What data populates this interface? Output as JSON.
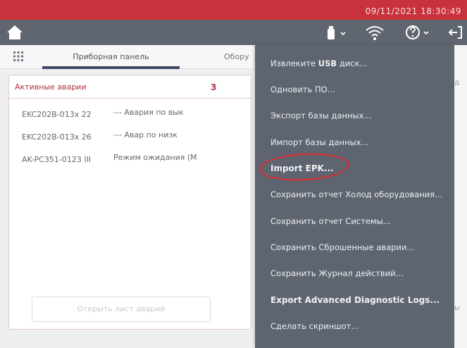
{
  "status_bar": {
    "datetime": "09/11/2021 18:30:49"
  },
  "tabs": [
    {
      "label": "Приборная панель"
    },
    {
      "label": "Обору"
    }
  ],
  "alarms": {
    "title": "Активные аварии",
    "count": "3",
    "rows": [
      {
        "device": "EKC202B-013x 22",
        "description": "--- Авария по вык"
      },
      {
        "device": "EKC202B-013x 26",
        "description": "--- Авар по низк"
      },
      {
        "device": "AK-PC351-0123 III",
        "description": "Режим ожидания (М"
      }
    ],
    "open_button": "Открыть лист аварий"
  },
  "right_peek": {
    "char1": "д",
    "char2": "ы"
  },
  "menu": {
    "items": [
      {
        "prefix": "Извлеките ",
        "strong": "USB",
        "suffix": " диск..."
      },
      {
        "label": "Одновить ПО..."
      },
      {
        "label": "Экспорт базы данных..."
      },
      {
        "label": "Импорт базы данных..."
      },
      {
        "label": "Import EPK..."
      },
      {
        "label": "Сохранить отчет Холод оборудования..."
      },
      {
        "label": "Сохранить отчет Системы..."
      },
      {
        "label": "Сохранить Сброшенные аварии..."
      },
      {
        "label": "Сохранить Журнал действий..."
      },
      {
        "label": "Export Advanced Diagnostic Logs..."
      },
      {
        "label": "Сделать скриншот..."
      }
    ]
  },
  "colors": {
    "status_red": "#c8323c",
    "header_gray": "#5f6670",
    "menu_bg": "#5e6570",
    "alarm_red": "#b0303a",
    "annotation_red": "#e1282e"
  }
}
